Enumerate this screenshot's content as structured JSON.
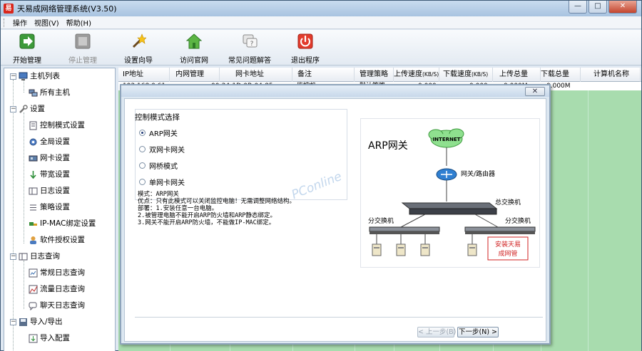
{
  "window": {
    "title": "天易成网络管理系统(V3.50)",
    "app_icon_char": "易",
    "minimize": "—",
    "maximize": "□",
    "close": "✕"
  },
  "menu": {
    "items": [
      "操作",
      "视图(V)",
      "帮助(H)"
    ]
  },
  "toolbar": {
    "items": [
      {
        "label": "开始管理",
        "icon": "start-manage-icon",
        "enabled": true
      },
      {
        "label": "停止管理",
        "icon": "stop-manage-icon",
        "enabled": false
      },
      {
        "label": "设置向导",
        "icon": "setup-wizard-icon",
        "enabled": true
      },
      {
        "label": "访问官网",
        "icon": "home-icon",
        "enabled": true
      },
      {
        "label": "常见问题解答",
        "icon": "faq-icon",
        "enabled": true
      },
      {
        "label": "退出程序",
        "icon": "exit-icon",
        "enabled": true
      }
    ]
  },
  "tree": {
    "host_list": "主机列表",
    "all_hosts": "所有主机",
    "settings": "设置",
    "settings_items": [
      "控制模式设置",
      "全局设置",
      "网卡设置",
      "带宽设置",
      "日志设置",
      "策略设置",
      "IP-MAC绑定设置",
      "软件授权设置"
    ],
    "log_query": "日志查询",
    "log_items": [
      "常规日志查询",
      "流量日志查询",
      "聊天日志查询"
    ],
    "import_export": "导入/导出",
    "import_items": [
      "导入配置"
    ]
  },
  "grid": {
    "columns": [
      "IP地址",
      "内网管理",
      "网卡地址",
      "备注",
      "管理策略",
      "上传速度",
      "下载速度",
      "上传总量",
      "下载总量",
      "计算机名称"
    ],
    "speed_unit": "(KB/S)",
    "row_partial": [
      "192.168.0.61",
      "00-24-1D-0B-04-85",
      "监控机",
      "默认策略",
      "0.000",
      "0.000",
      "0.000M",
      "0.000M"
    ]
  },
  "dialog": {
    "close_label": "✕",
    "group_title": "控制模式选择",
    "modes": [
      "ARP网关",
      "双网卡网关",
      "网桥模式",
      "单网卡网关"
    ],
    "selected_mode": 0,
    "desc_lines": [
      "模式：ARP网关",
      "优点：只有此模式可以关闭监控电脑！无需调整网络结构。",
      "部署：1.安装任意一台电脑。",
      "      2.被管理电脑不能开启ARP防火墙和ARP静态绑定。",
      "      3.网关不能开启ARP防火墙，不能做IP-MAC绑定。"
    ],
    "diagram": {
      "title": "ARP网关",
      "internet": "INTERNET",
      "router_label": "网关/路由器",
      "core_switch": "总交换机",
      "sub_switch_left": "分交换机",
      "sub_switch_right": "分交换机",
      "install_note_line1": "安装天易",
      "install_note_line2": "成网管",
      "watermark": "PConline"
    },
    "prev_button": "< 上一步(B)",
    "next_button": "下一步(N) >"
  },
  "colors": {
    "grid_bg": "#a8dcae",
    "dialog_bg": "#dce7f1",
    "accent_red": "#d9261c"
  }
}
